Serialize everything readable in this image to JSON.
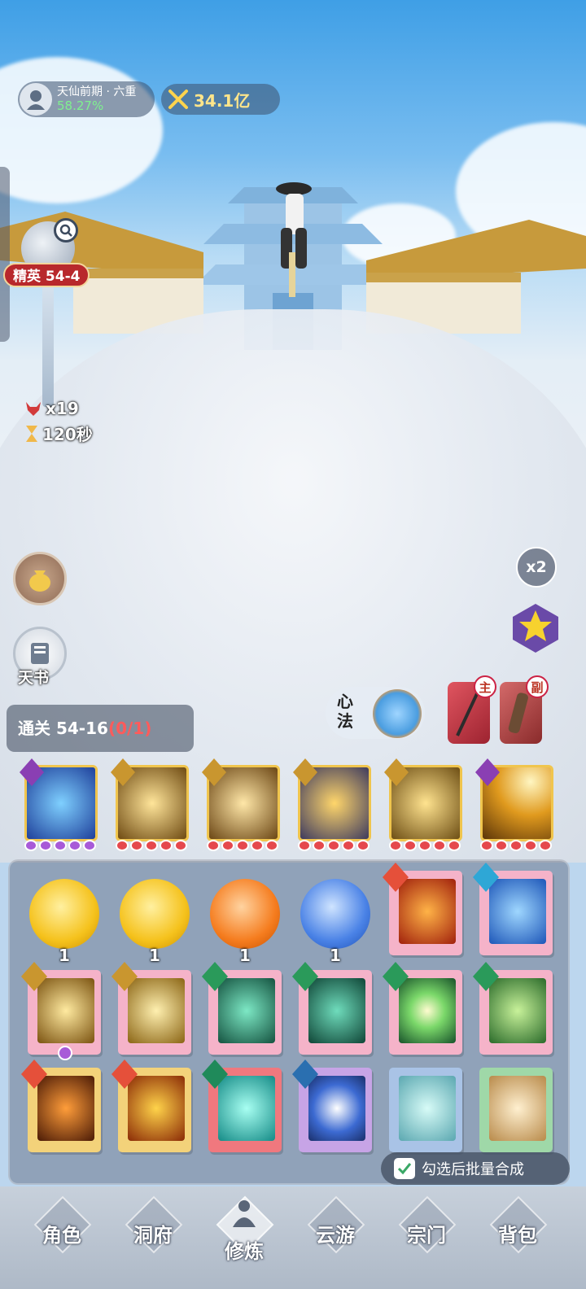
{
  "hud": {
    "realm_name": "天仙前期 · 六重",
    "realm_progress": "58.27%",
    "combat_power": "34.1亿"
  },
  "stage": {
    "label": "精英 54-4",
    "enemies": "x19",
    "timer": "120秒"
  },
  "side": {
    "book_label": "天书",
    "speed_label": "x2"
  },
  "mind_method": {
    "label": "心法"
  },
  "weapons": {
    "main_badge": "主",
    "sub_badge": "副"
  },
  "clear": {
    "label": "通关 54-16",
    "progress": "(0/1)"
  },
  "orbs": [
    {
      "count": "1",
      "color": "gold"
    },
    {
      "count": "1",
      "color": "gold"
    },
    {
      "count": "1",
      "color": "orange"
    },
    {
      "count": "1",
      "color": "blue"
    }
  ],
  "batch": {
    "label": "勾选后批量合成",
    "checked": true
  },
  "nav": {
    "items": [
      "角色",
      "洞府",
      "修炼",
      "云游",
      "宗门",
      "背包"
    ],
    "active": "修炼"
  },
  "colors": {
    "accent_red": "#b8282c",
    "power_gold": "#ffe58a",
    "progress_green": "#7ff08f",
    "clear_progress": "#ff5b5b"
  }
}
